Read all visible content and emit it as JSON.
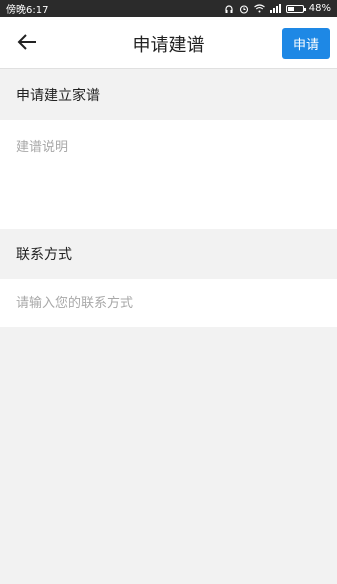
{
  "status_bar": {
    "time": "傍晚6:17",
    "battery": "48%",
    "battery_level": 0.48
  },
  "header": {
    "title": "申请建谱",
    "apply_label": "申请"
  },
  "sections": {
    "family_tree": {
      "header": "申请建立家谱",
      "placeholder": "建谱说明"
    },
    "contact": {
      "header": "联系方式",
      "placeholder": "请输入您的联系方式"
    }
  },
  "colors": {
    "accent": "#1e88e5",
    "status_bar": "#2b2b2b",
    "background": "#f2f2f2"
  }
}
